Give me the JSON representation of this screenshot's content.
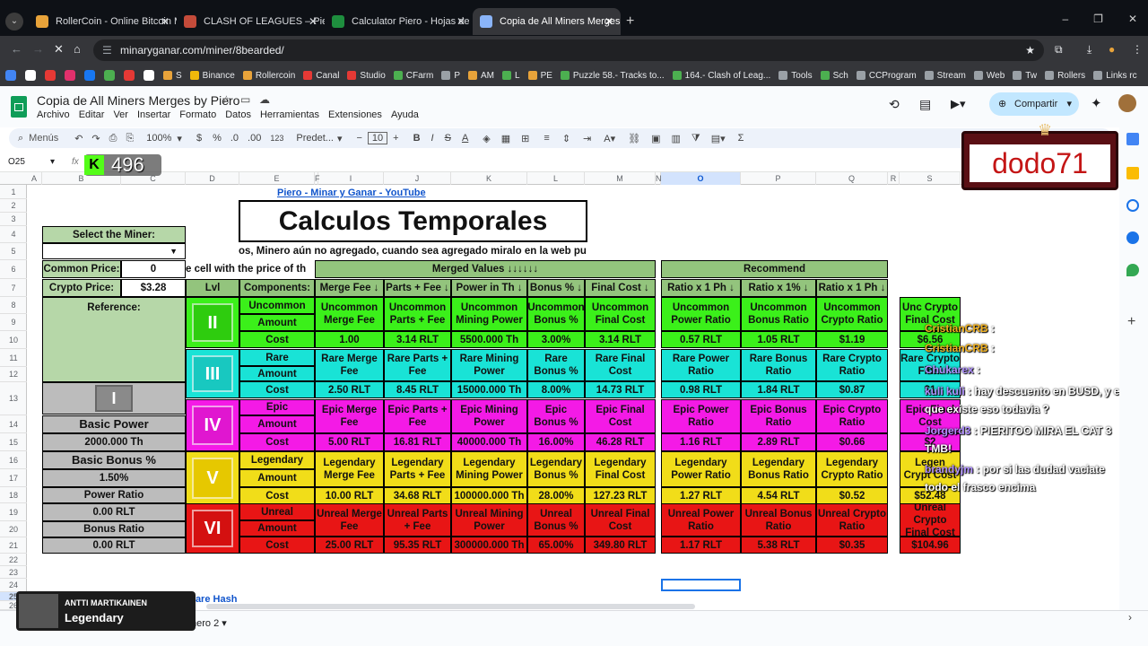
{
  "tabs": [
    {
      "label": "RollerCoin - Online Bitcoin Mini",
      "color": "#e8a33a"
    },
    {
      "label": "CLASH OF LEAGUES – Piero",
      "color": "#c44b3a"
    },
    {
      "label": "Calculator Piero - Hojas de cálc",
      "color": "#1e8e3e"
    },
    {
      "label": "Copia de All Miners Merges by",
      "color": "#8ab4f8"
    }
  ],
  "url": "minaryganar.com/miner/8bearded/",
  "bookmarks": [
    "S",
    "Binance",
    "Rollercoin",
    "Canal",
    "Studio",
    "CFarm",
    "P",
    "AM",
    "L",
    "PE",
    "Puzzle 58.- Tracks to...",
    "164.- Clash of Leag...",
    "Tools",
    "Sch",
    "CCProgram",
    "Stream",
    "Web",
    "Tw",
    "Rollers",
    "Links rc"
  ],
  "doc": {
    "title": "Copia de All Miners Merges by Piero",
    "menus": [
      "Archivo",
      "Editar",
      "Ver",
      "Insertar",
      "Formato",
      "Datos",
      "Herramientas",
      "Extensiones",
      "Ayuda"
    ],
    "share": "Compartir"
  },
  "toolbar": {
    "menus": "Menús",
    "zoom": "100%",
    "currency": "$",
    "percent": "%",
    "dec_dec": ".0",
    "dec_inc": ".00",
    "numfmt": "123",
    "font": "Predet...",
    "size": "10"
  },
  "namebox": "O25",
  "overlay": {
    "k_count": "496",
    "streamer": "dodo71"
  },
  "columns": [
    "A",
    "B",
    "C",
    "D",
    "E",
    "F",
    "I",
    "J",
    "K",
    "L",
    "M",
    "N",
    "O",
    "P",
    "Q",
    "R",
    "S",
    "T",
    "U"
  ],
  "rows": [
    "1",
    "2",
    "3",
    "4",
    "5",
    "6",
    "7",
    "8",
    "9",
    "10",
    "11",
    "12",
    "13",
    "14",
    "15",
    "16",
    "17",
    "18",
    "19",
    "20",
    "21",
    "22",
    "23",
    "24",
    "25",
    "26"
  ],
  "sheet": {
    "link": "Piero - Minar y Ganar - YouTube",
    "title": "Calculos Temporales",
    "note": "os, Minero aún no agregado, cuando sea agregado miralo en la web pu",
    "select_miner": "Select the Miner:",
    "common_price_label": "Common Price:",
    "common_price": "0",
    "crypto_price_label": "Crypto Price:",
    "crypto_price": "$3.28",
    "cell_hint": "e cell with the price of th",
    "merged_values": "Merged Values ↓↓↓↓↓↓",
    "recommend": "Recommend",
    "lvl": "Lvl",
    "components": "Components:",
    "headers": [
      "Merge Fee ↓",
      "Parts + Fee ↓",
      "Power in Th ↓",
      "Bonus % ↓",
      "Final Cost ↓"
    ],
    "rec_headers": [
      "Ratio x 1 Ph ↓",
      "Ratio x 1% ↓",
      "Ratio x 1 Ph ↓"
    ],
    "reference": "Reference:",
    "basic_power_label": "Basic Power",
    "basic_power": "2000.000 Th",
    "basic_bonus_label": "Basic Bonus %",
    "basic_bonus": "1.50%",
    "power_ratio_label": "Power Ratio",
    "power_ratio": "0.00 RLT",
    "bonus_ratio_label": "Bonus Ratio",
    "bonus_ratio": "0.00 RLT",
    "bottom_link": "Rare Hash",
    "sheet_tab": "nero 2"
  },
  "levels": [
    {
      "badge": "II",
      "cls": "u",
      "c1": "Uncommon",
      "c2": "Amount",
      "c3": "Cost",
      "lab": [
        "Uncommon Merge Fee",
        "Uncommon Parts + Fee",
        "Uncommon Mining Power",
        "Uncommon Bonus %",
        "Uncommon Final Cost"
      ],
      "val": [
        "1.00",
        "3.14 RLT",
        "5500.000 Th",
        "3.00%",
        "3.14 RLT"
      ],
      "rlab": [
        "Uncommon Power Ratio",
        "Uncommon Bonus Ratio",
        "Uncommon Crypto Ratio"
      ],
      "rval": [
        "0.57 RLT",
        "1.05 RLT",
        "$1.19"
      ],
      "slab": "Unc Crypto Final Cost",
      "sval": "$6.56"
    },
    {
      "badge": "III",
      "cls": "c",
      "c1": "Rare",
      "c2": "Amount",
      "c3": "Cost",
      "lab": [
        "Rare Merge Fee",
        "Rare Parts + Fee",
        "Rare Mining Power",
        "Rare Bonus %",
        "Rare Final Cost"
      ],
      "val": [
        "2.50 RLT",
        "8.45 RLT",
        "15000.000 Th",
        "8.00%",
        "14.73 RLT"
      ],
      "rlab": [
        "Rare Power Ratio",
        "Rare Bonus Ratio",
        "Rare Crypto Ratio"
      ],
      "rval": [
        "0.98 RLT",
        "1.84 RLT",
        "$0.87"
      ],
      "slab": "Rare Crypto Final",
      "sval": "$1"
    },
    {
      "badge": "IV",
      "cls": "m",
      "c1": "Epic",
      "c2": "Amount",
      "c3": "Cost",
      "lab": [
        "Epic Merge Fee",
        "Epic Parts + Fee",
        "Epic Mining Power",
        "Epic Bonus %",
        "Epic Final Cost"
      ],
      "val": [
        "5.00 RLT",
        "16.81 RLT",
        "40000.000 Th",
        "16.00%",
        "46.28 RLT"
      ],
      "rlab": [
        "Epic Power Ratio",
        "Epic Bonus Ratio",
        "Epic Crypto Ratio"
      ],
      "rval": [
        "1.16 RLT",
        "2.89 RLT",
        "$0.66"
      ],
      "slab": "Epic Final Cost",
      "sval": "$2"
    },
    {
      "badge": "V",
      "cls": "y",
      "c1": "Legendary",
      "c2": "Amount",
      "c3": "Cost",
      "lab": [
        "Legendary Merge Fee",
        "Legendary Parts + Fee",
        "Legendary Mining Power",
        "Legendary Bonus %",
        "Legendary Final Cost"
      ],
      "val": [
        "10.00 RLT",
        "34.68 RLT",
        "100000.000 Th",
        "28.00%",
        "127.23 RLT"
      ],
      "rlab": [
        "Legendary Power Ratio",
        "Legendary Bonus Ratio",
        "Legendary Crypto Ratio"
      ],
      "rval": [
        "1.27 RLT",
        "4.54 RLT",
        "$0.52"
      ],
      "slab": "Legen Crypt Cost",
      "sval": "$52.48"
    },
    {
      "badge": "VI",
      "cls": "r",
      "c1": "Unreal",
      "c2": "Amount",
      "c3": "Cost",
      "lab": [
        "Unreal Merge Fee",
        "Unreal Parts + Fee",
        "Unreal Mining Power",
        "Unreal Bonus %",
        "Unreal Final Cost"
      ],
      "val": [
        "25.00 RLT",
        "95.35 RLT",
        "300000.000 Th",
        "65.00%",
        "349.80 RLT"
      ],
      "rlab": [
        "Unreal Power Ratio",
        "Unreal Bonus Ratio",
        "Unreal Crypto Ratio"
      ],
      "rval": [
        "1.17 RLT",
        "5.38 RLT",
        "$0.35"
      ],
      "slab": "Unreal Crypto Final Cost",
      "sval": "$104.96"
    }
  ],
  "chat": [
    {
      "user": "CristianCRB",
      "msg": ""
    },
    {
      "user": "CristianCRB",
      "msg": ""
    },
    {
      "user": "Chukarex",
      "msg": ""
    },
    {
      "user": "kuli kuli",
      "msg": "hay descuento en BUSD, y es"
    },
    {
      "user": "",
      "msg": "que existe eso todavia ?"
    },
    {
      "user": "Jorgerd3",
      "msg": "PIERITOO MIRA EL CAT 3"
    },
    {
      "user": "",
      "msg": "TMB!"
    },
    {
      "user": "brandyjm",
      "msg": "por si las dudad vaciate"
    },
    {
      "user": "",
      "msg": "todo el frasco encima"
    }
  ],
  "achievement": {
    "name": "ANTTI MARTIKAINEN",
    "tier": "Legendary"
  },
  "colors": {
    "uncommon": "#3bf01a",
    "rare": "#19e3d6",
    "epic": "#f41ae6",
    "legendary": "#f1dd19",
    "unreal": "#e81515",
    "header_green": "#93c47d"
  }
}
